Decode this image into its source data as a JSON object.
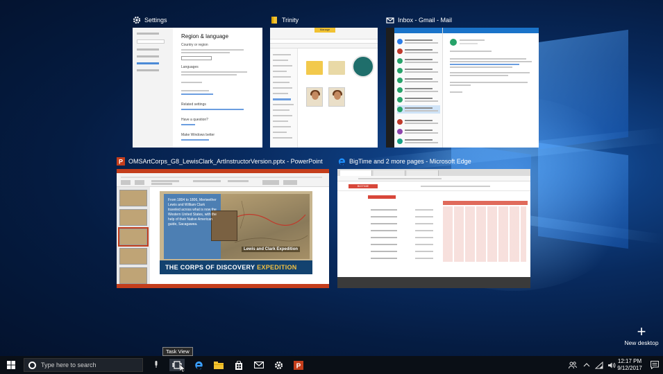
{
  "windows": {
    "settings": {
      "title": "Settings",
      "heading": "Region & language",
      "sub1": "Country or region",
      "sub2": "Languages",
      "sub3": "Related settings",
      "sub4": "Have a question?",
      "sub5": "Make Windows better"
    },
    "explorer": {
      "title": "Trinity",
      "tab_label": "Manage"
    },
    "mail": {
      "title": "Inbox - Gmail - Mail"
    },
    "powerpoint": {
      "title": "OMSArtCorps_G8_LewisClark_ArtInstructorVersion.pptx - PowerPoint",
      "slide_text": "From 1804 to 1806, Meriwether Lewis and William Clark traveled across what is now the Western United States, with the help of their Native American guide, Sacagawea.",
      "map_caption": "Lewis and Clark Expedition",
      "caption_plain": "THE CORPS OF DISCOVERY",
      "caption_gold": " EXPEDITION"
    },
    "edge": {
      "title": "BigTime and 2 more pages - Microsoft Edge",
      "site_logo": "BIGTIME"
    }
  },
  "new_desktop": {
    "label": "New desktop"
  },
  "tooltip": {
    "text": "Task View"
  },
  "taskbar": {
    "search_placeholder": "Type here to search",
    "apps": [
      "task-view",
      "edge",
      "file-explorer",
      "store",
      "mail",
      "settings",
      "powerpoint"
    ],
    "active_app": "task-view",
    "clock": {
      "time": "12:17 PM",
      "date": "9/12/2017"
    }
  },
  "colors": {
    "taskbar": "#0a0f16",
    "accent_edge": "#1e90ff",
    "powerpoint": "#c43e1c",
    "explorer_folder": "#f1c232",
    "mail": "#1a73c9"
  }
}
